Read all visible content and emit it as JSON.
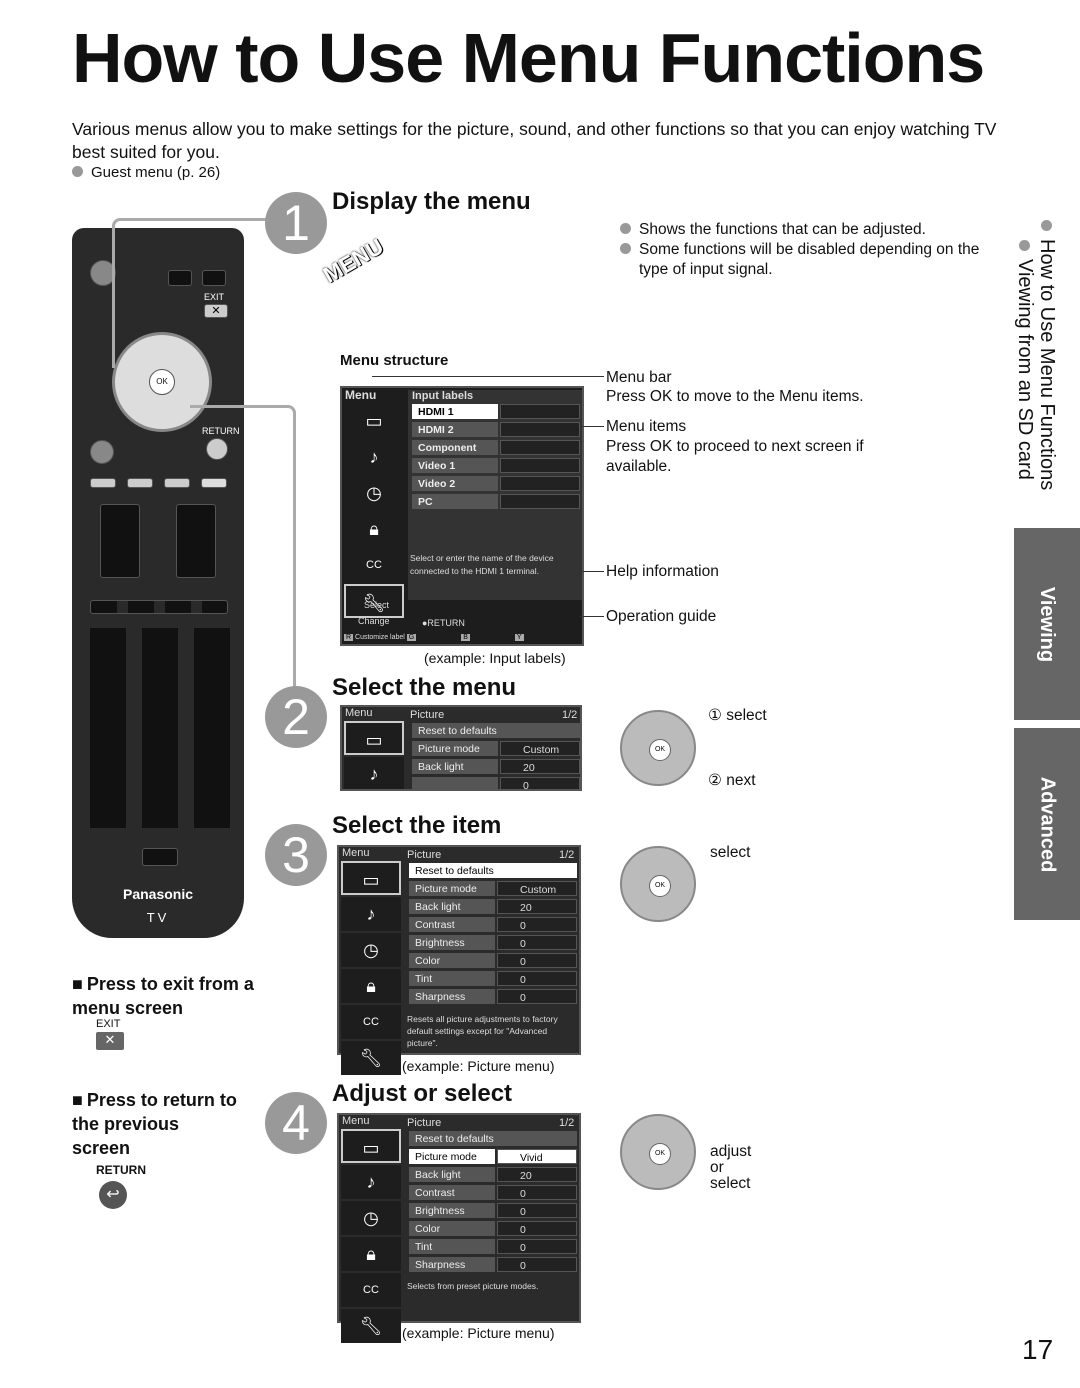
{
  "title": "How to Use Menu Functions",
  "intro": "Various menus allow you to make settings for the picture, sound, and other functions so that you can enjoy watching TV best suited for you.",
  "guest_menu": "Guest menu (p. 26)",
  "steps": [
    {
      "num": "1",
      "title": "Display the menu",
      "notes": [
        "Shows the functions that can be adjusted.",
        "Some functions will be disabled depending on the type of input signal."
      ],
      "menu_button": "MENU"
    },
    {
      "num": "2",
      "title": "Select the menu",
      "select": "① select",
      "next": "② next"
    },
    {
      "num": "3",
      "title": "Select the item",
      "select": "select"
    },
    {
      "num": "4",
      "title": "Adjust or select",
      "adjust": "adjust",
      "or": "or",
      "select": "select"
    }
  ],
  "menu_structure": {
    "heading": "Menu structure",
    "menu_label": "Menu",
    "panel_title": "Input labels",
    "items": [
      "HDMI 1",
      "HDMI 2",
      "Component",
      "Video 1",
      "Video 2",
      "PC"
    ],
    "help": "Select or enter the name of the device connected to the HDMI 1 terminal.",
    "guide_select": "Select",
    "guide_change": "Change",
    "guide_return": "●RETURN",
    "color_keys": [
      "R",
      "Customize label",
      "G",
      "B",
      "Y"
    ],
    "caption": "(example: Input labels)",
    "callouts": {
      "menu_bar": "Menu bar",
      "menu_bar_desc": "Press OK to move to the Menu items.",
      "menu_items": "Menu items",
      "menu_items_desc": "Press OK to proceed to next screen if available.",
      "help_info": "Help information",
      "op_guide": "Operation guide"
    }
  },
  "picture_menu": {
    "menu_label": "Menu",
    "title": "Picture",
    "page": "1/2",
    "rows": [
      {
        "k": "Reset to defaults",
        "v": ""
      },
      {
        "k": "Picture mode",
        "v": "Custom"
      },
      {
        "k": "Back light",
        "v": "20"
      },
      {
        "k": "Contrast",
        "v": "0"
      },
      {
        "k": "Brightness",
        "v": "0"
      },
      {
        "k": "Color",
        "v": "0"
      },
      {
        "k": "Tint",
        "v": "0"
      },
      {
        "k": "Sharpness",
        "v": "0"
      }
    ],
    "help3": "Resets all picture adjustments to factory default settings except for \"Advanced picture\".",
    "mode4": "Vivid",
    "help4": "Selects from preset picture modes.",
    "caption": "(example:  Picture menu)"
  },
  "remote": {
    "exit": "EXIT",
    "return": "RETURN",
    "ok": "OK",
    "menu": "MENU",
    "brand": "Panasonic",
    "tv": "TV"
  },
  "exit_section": {
    "title": "Press to exit from a menu screen",
    "label": "EXIT"
  },
  "return_section": {
    "title": "Press to return to the previous screen",
    "label": "RETURN"
  },
  "side_tabs": {
    "sub1": "How to Use Menu Functions",
    "sub2": "Viewing from an SD card",
    "viewing": "Viewing",
    "advanced": "Advanced"
  },
  "page_number": "17"
}
